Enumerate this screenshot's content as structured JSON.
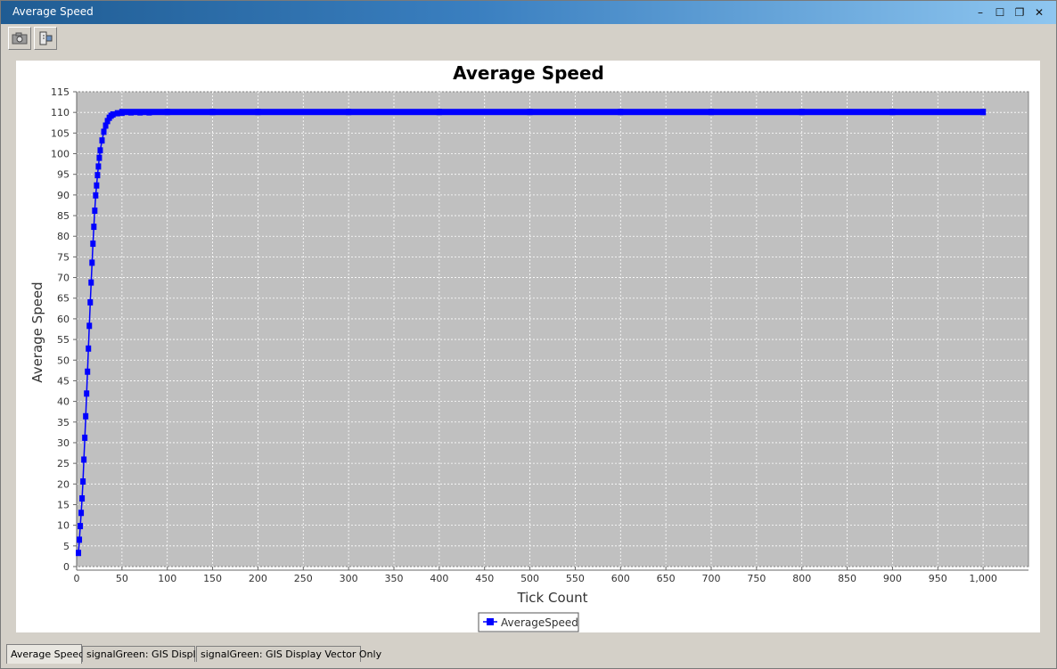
{
  "window": {
    "title": "Average Speed"
  },
  "window_controls": {
    "minimize": "–",
    "maximize": "☐",
    "restore": "❐",
    "close": "✕"
  },
  "toolbar": {
    "buttons": [
      "camera-icon",
      "export-icon"
    ]
  },
  "tabs": [
    {
      "label": "Average Speed",
      "active": true
    },
    {
      "label": "signalGreen: GIS Display",
      "active": false
    },
    {
      "label": "signalGreen: GIS Display Vector Only",
      "active": false
    }
  ],
  "colors": {
    "plot_bg": "#c0c0c0",
    "series": "#0000ff",
    "grid": "#ffffff"
  },
  "chart_data": {
    "type": "line",
    "title": "Average Speed",
    "xlabel": "Tick Count",
    "ylabel": "Average Speed",
    "xlim": [
      0,
      1050
    ],
    "ylim": [
      0,
      115
    ],
    "x_ticks": [
      0,
      50,
      100,
      150,
      200,
      250,
      300,
      350,
      400,
      450,
      500,
      550,
      600,
      650,
      700,
      750,
      800,
      850,
      900,
      950,
      1000
    ],
    "x_tick_labels": [
      "0",
      "50",
      "100",
      "150",
      "200",
      "250",
      "300",
      "350",
      "400",
      "450",
      "500",
      "550",
      "600",
      "650",
      "700",
      "750",
      "800",
      "850",
      "900",
      "950",
      "1,000"
    ],
    "y_ticks": [
      0,
      5,
      10,
      15,
      20,
      25,
      30,
      35,
      40,
      45,
      50,
      55,
      60,
      65,
      70,
      75,
      80,
      85,
      90,
      95,
      100,
      105,
      110,
      115
    ],
    "grid": true,
    "legend": "bottom",
    "series": [
      {
        "name": "AverageSpeed",
        "markers": "square",
        "x": [
          2,
          3,
          4,
          5,
          6,
          7,
          8,
          9,
          10,
          11,
          12,
          13,
          14,
          15,
          16,
          17,
          18,
          19,
          20,
          21,
          22,
          23,
          24,
          25,
          26,
          28,
          30,
          32,
          34,
          36,
          38,
          40,
          45,
          50,
          60,
          70,
          80,
          100,
          150,
          200,
          300,
          400,
          500,
          600,
          700,
          800,
          900,
          1000
        ],
        "y": [
          3.3,
          6.5,
          9.8,
          13.0,
          16.5,
          20.6,
          25.9,
          31.2,
          36.4,
          41.9,
          47.2,
          52.8,
          58.3,
          64.0,
          68.8,
          73.6,
          78.2,
          82.3,
          86.2,
          89.9,
          92.3,
          94.8,
          96.9,
          99.0,
          100.8,
          103.2,
          105.3,
          106.8,
          107.9,
          108.7,
          109.2,
          109.5,
          109.8,
          109.9,
          110.0,
          110.0,
          110.0,
          110.1,
          110.1,
          110.1,
          110.1,
          110.1,
          110.1,
          110.1,
          110.1,
          110.1,
          110.1,
          110.1
        ]
      }
    ]
  }
}
